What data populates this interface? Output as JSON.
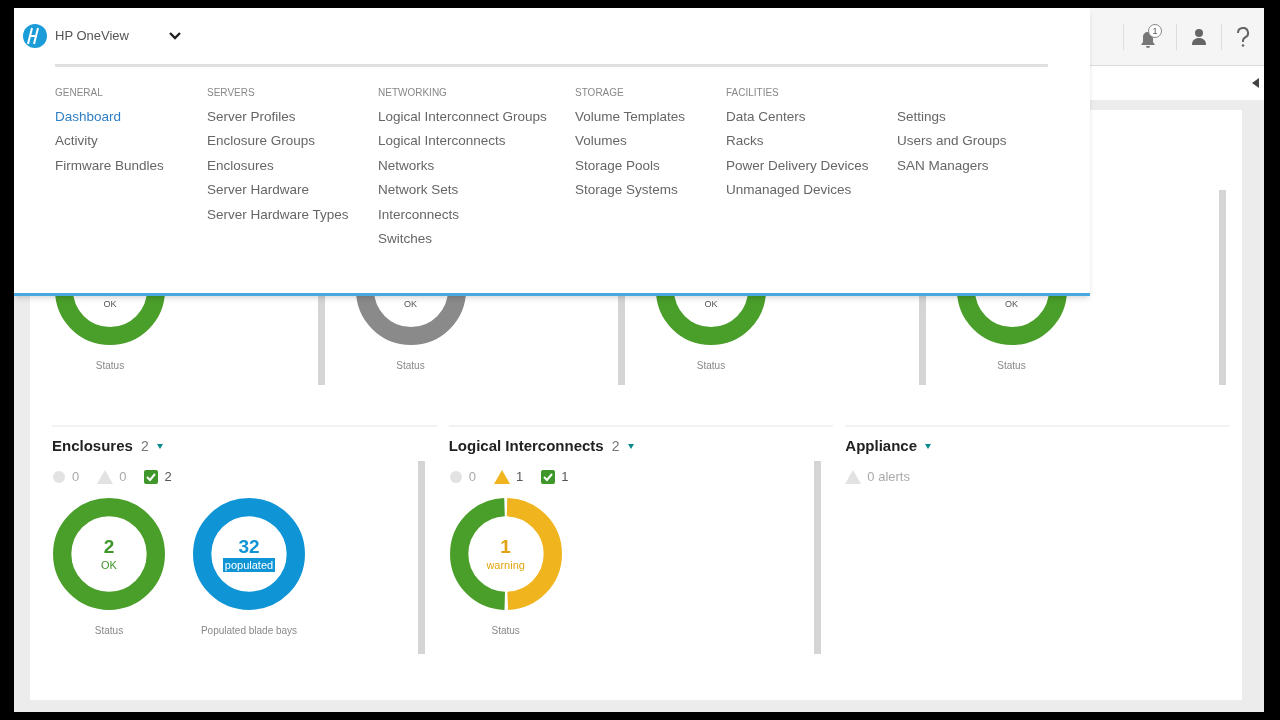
{
  "app": {
    "title": "HP OneView",
    "notifications": "1"
  },
  "menu": {
    "columns": [
      {
        "heading": "GENERAL",
        "items": [
          {
            "label": "Dashboard",
            "selected": true
          },
          {
            "label": "Activity",
            "selected": false
          },
          {
            "label": "Firmware Bundles",
            "selected": false
          }
        ]
      },
      {
        "heading": "SERVERS",
        "items": [
          {
            "label": "Server Profiles",
            "selected": false
          },
          {
            "label": "Enclosure Groups",
            "selected": false
          },
          {
            "label": "Enclosures",
            "selected": false
          },
          {
            "label": "Server Hardware",
            "selected": false
          },
          {
            "label": "Server Hardware Types",
            "selected": false
          }
        ]
      },
      {
        "heading": "NETWORKING",
        "items": [
          {
            "label": "Logical Interconnect Groups",
            "selected": false
          },
          {
            "label": "Logical Interconnects",
            "selected": false
          },
          {
            "label": "Networks",
            "selected": false
          },
          {
            "label": "Network Sets",
            "selected": false
          },
          {
            "label": "Interconnects",
            "selected": false
          },
          {
            "label": "Switches",
            "selected": false
          }
        ]
      },
      {
        "heading": "STORAGE",
        "items": [
          {
            "label": "Volume Templates",
            "selected": false
          },
          {
            "label": "Volumes",
            "selected": false
          },
          {
            "label": "Storage Pools",
            "selected": false
          },
          {
            "label": "Storage Systems",
            "selected": false
          }
        ]
      },
      {
        "heading": "FACILITIES",
        "items": [
          {
            "label": "Data Centers",
            "selected": false
          },
          {
            "label": "Racks",
            "selected": false
          },
          {
            "label": "Power Delivery Devices",
            "selected": false
          },
          {
            "label": "Unmanaged Devices",
            "selected": false
          }
        ]
      },
      {
        "items": [
          {
            "label": "Settings",
            "selected": false
          },
          {
            "label": "Users and Groups",
            "selected": false
          },
          {
            "label": "SAN Managers",
            "selected": false
          }
        ]
      }
    ]
  },
  "top_panels": [
    {
      "label": "OK",
      "caption": "Status",
      "color": "#4a9e2a"
    },
    {
      "label": "OK",
      "caption": "Status",
      "color": "#8a8a8a"
    },
    {
      "label": "OK",
      "caption": "Status",
      "color": "#4a9e2a"
    },
    {
      "label": "OK",
      "caption": "Status",
      "color": "#4a9e2a"
    }
  ],
  "bottom_panels": [
    {
      "kind": "counts",
      "title": "Enclosures",
      "count": "2",
      "counts": [
        {
          "kind": "disabled",
          "value": "0",
          "active": false
        },
        {
          "kind": "warning",
          "value": "0",
          "active": false
        },
        {
          "kind": "ok",
          "value": "2",
          "active": true
        }
      ],
      "charts": [
        {
          "kind": "ok",
          "value": "2",
          "label": "OK",
          "caption": "Status",
          "segments": [
            {
              "color": "#4a9e2a"
            }
          ]
        },
        {
          "kind": "populated",
          "value": "32",
          "label": "populated",
          "caption": "Populated blade bays",
          "segments": [
            {
              "color": "#0f94d6"
            }
          ]
        }
      ]
    },
    {
      "kind": "counts",
      "title": "Logical Interconnects",
      "count": "2",
      "counts": [
        {
          "kind": "disabled",
          "value": "0",
          "active": false
        },
        {
          "kind": "warning",
          "value": "1",
          "active": true
        },
        {
          "kind": "ok",
          "value": "1",
          "active": true
        }
      ],
      "charts": [
        {
          "kind": "warning",
          "value": "1",
          "label": "warning",
          "caption": "Status",
          "segments": [
            {
              "color": "#4a9e2a"
            },
            {
              "color": "#f0b41e"
            }
          ]
        }
      ]
    },
    {
      "kind": "alerts",
      "title": "Appliance",
      "alerts": "0 alerts"
    }
  ]
}
